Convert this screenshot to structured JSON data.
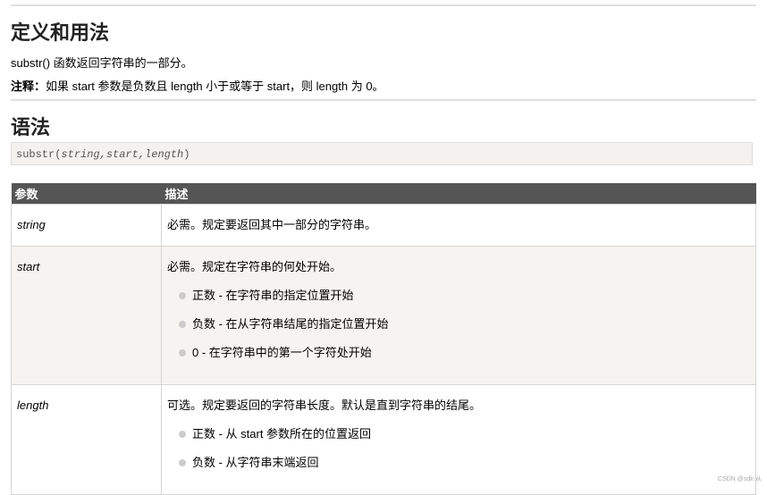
{
  "section1": {
    "title": "定义和用法",
    "desc": "substr() 函数返回字符串的一部分。",
    "note_label": "注释：",
    "note": "如果 start 参数是负数且 length 小于或等于 start，则 length 为 0。"
  },
  "section2": {
    "title": "语法",
    "code_fn": "substr(",
    "code_args": "string,start,length",
    "code_end": ")"
  },
  "table": {
    "headers": [
      "参数",
      "描述"
    ],
    "rows": [
      {
        "param": "string",
        "desc": "必需。规定要返回其中一部分的字符串。",
        "items": []
      },
      {
        "param": "start",
        "desc": "必需。规定在字符串的何处开始。",
        "items": [
          "正数 - 在字符串的指定位置开始",
          "负数 - 在从字符串结尾的指定位置开始",
          "0 - 在字符串中的第一个字符处开始"
        ]
      },
      {
        "param": "length",
        "desc": "可选。规定要返回的字符串长度。默认是直到字符串的结尾。",
        "items": [
          "正数 - 从 start 参数所在的位置返回",
          "负数 - 从字符串末端返回"
        ]
      }
    ]
  },
  "watermark": "CSDN @sdk-从"
}
